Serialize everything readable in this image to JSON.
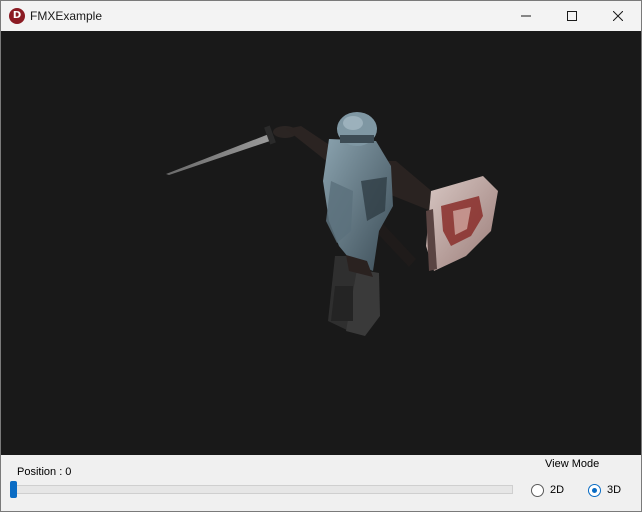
{
  "window": {
    "title": "FMXExample",
    "icon_letter": "D"
  },
  "title_buttons": {
    "minimize_icon": "minimize-icon",
    "maximize_icon": "maximize-icon",
    "close_icon": "close-icon"
  },
  "viewport": {
    "background_color": "#191919",
    "content": "3d-knight-model"
  },
  "controls": {
    "position_label": "Position : 0",
    "position_value": 0,
    "view_mode_label": "View Mode",
    "options": [
      {
        "label": "2D",
        "checked": false
      },
      {
        "label": "3D",
        "checked": true
      }
    ]
  },
  "colors": {
    "accent": "#0a6cc4",
    "icon_bg": "#8b1b23"
  }
}
